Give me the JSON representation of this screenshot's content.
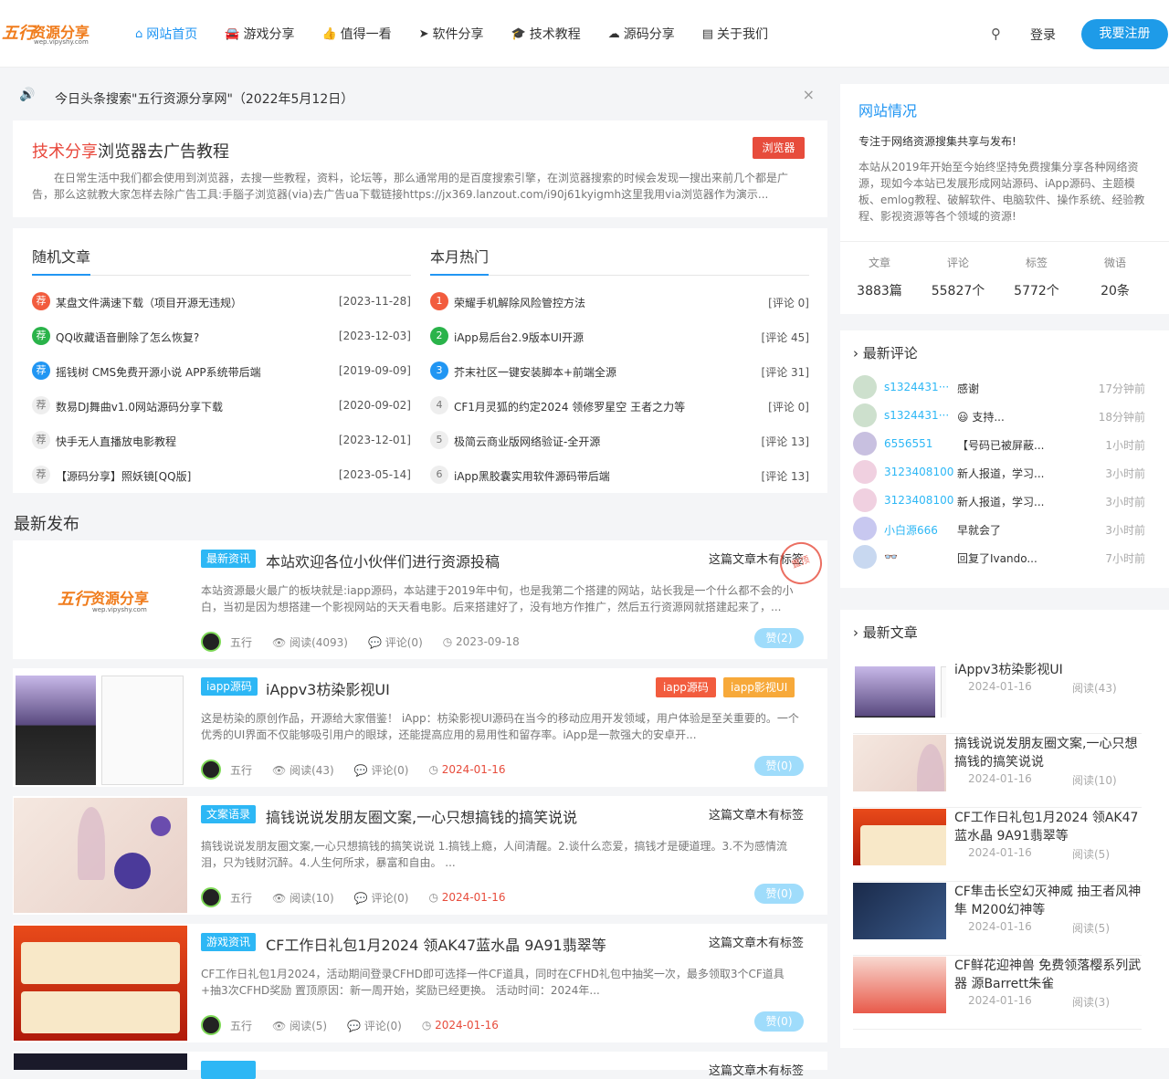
{
  "header": {
    "logo_main": "资源分享",
    "logo_mark": "五行",
    "logo_url": "wep.vipyshy.com",
    "nav": [
      {
        "label": "网站首页",
        "icon": "home-icon",
        "glyph": "⌂"
      },
      {
        "label": "游戏分享",
        "icon": "car-icon",
        "glyph": "🚘"
      },
      {
        "label": "值得一看",
        "icon": "thumbs-up-icon",
        "glyph": "👍"
      },
      {
        "label": "软件分享",
        "icon": "send-icon",
        "glyph": "➤"
      },
      {
        "label": "技术教程",
        "icon": "graduation-cap-icon",
        "glyph": "🎓"
      },
      {
        "label": "源码分享",
        "icon": "cloud-download-icon",
        "glyph": "☁"
      },
      {
        "label": "关于我们",
        "icon": "id-card-icon",
        "glyph": "▤"
      }
    ],
    "login": "登录",
    "register": "我要注册"
  },
  "notice": {
    "text": "今日头条搜索\"五行资源分享网\"（2022年5月12日）",
    "close": "×"
  },
  "feature": {
    "title_hl": "技术分享",
    "title": "浏览器去广告教程",
    "tag": "浏览器",
    "desc": "在日常生活中我们都会使用到浏览器，去搜一些教程，资料，论坛等，那么通常用的是百度搜索引擎，在浏览器搜索的时候会发现一搜出来前几个都是广告，那么这就教大家怎样去除广告工具:手腦子浏览器(via)去广告ua下载链接https://jx369.lanzout.com/i90j61kyigmh这里我用via浏览器作为演示..."
  },
  "random": {
    "title": "随机文章",
    "items": [
      {
        "badge": "荐",
        "color": "#f25c3e",
        "title": "某盘文件满速下载（项目开源无违规）",
        "right": "[2023-11-28]"
      },
      {
        "badge": "荐",
        "color": "#2ab34a",
        "title": "QQ收藏语音删除了怎么恢复?",
        "right": "[2023-12-03]"
      },
      {
        "badge": "荐",
        "color": "#2196f3",
        "title": "摇钱树 CMS免费开源小说 APP系统带后端",
        "right": "[2019-09-09]"
      },
      {
        "badge": "荐",
        "color": "#eeeeee",
        "title": "数易DJ舞曲v1.0网站源码分享下载",
        "right": "[2020-09-02]"
      },
      {
        "badge": "荐",
        "color": "#eeeeee",
        "title": "快手无人直播放电影教程",
        "right": "[2023-12-01]"
      },
      {
        "badge": "荐",
        "color": "#eeeeee",
        "title": "【源码分享】照妖镜[QQ版]",
        "right": "[2023-05-14]"
      }
    ]
  },
  "hot": {
    "title": "本月热门",
    "items": [
      {
        "badge": "1",
        "color": "#f25c3e",
        "title": "荣耀手机解除风险管控方法",
        "right": "[评论 0]"
      },
      {
        "badge": "2",
        "color": "#2ab34a",
        "title": "iApp易后台2.9版本UI开源",
        "right": "[评论 45]"
      },
      {
        "badge": "3",
        "color": "#2196f3",
        "title": "芥末社区一键安装脚本+前端全源",
        "right": "[评论 31]"
      },
      {
        "badge": "4",
        "color": "#eeeeee",
        "title": "CF1月灵狐的约定2024 领修罗星空 王者之力等",
        "right": "[评论 0]"
      },
      {
        "badge": "5",
        "color": "#eeeeee",
        "title": "极简云商业版网络验证-全开源",
        "right": "[评论 13]"
      },
      {
        "badge": "6",
        "color": "#eeeeee",
        "title": "iApp黑胶囊实用软件源码带后端",
        "right": "[评论 13]"
      }
    ]
  },
  "latest_title": "最新发布",
  "posts": [
    {
      "cat": "最新资讯",
      "cat_color": "#2db7f5",
      "title": "本站欢迎各位小伙伴们进行资源投稿",
      "notag": "这篇文章木有标签",
      "stamp": "置顶",
      "desc": "本站资源最火最广的板块就是:iapp源码，本站建于2019年中旬，也是我第二个搭建的网站，站长我是一个什么都不会的小白，当初是因为想搭建一个影视网站的天天看电影。后来搭建好了，没有地方作推广，然后五行资源网就搭建起来了，...",
      "author": "五行",
      "views": "阅读(4093)",
      "comments": "评论(0)",
      "date": "2023-09-18",
      "date_red": false,
      "like": "赞(2)",
      "thumb": "logo"
    },
    {
      "cat": "iapp源码",
      "cat_color": "#2db7f5",
      "title": "iAppv3枋染影视UI",
      "tags": [
        {
          "label": "iapp源码",
          "color": "#f25c3e"
        },
        {
          "label": "iapp影视UI",
          "color": "#f7a93a"
        }
      ],
      "desc": "这是枋染的原创作品，开源给大家借鉴！ iApp：枋染影视UI源码在当今的移动应用开发领域，用户体验是至关重要的。一个优秀的UI界面不仅能够吸引用户的眼球，还能提高应用的易用性和留存率。iApp是一款强大的安卓开...",
      "author": "五行",
      "views": "阅读(43)",
      "comments": "评论(0)",
      "date": "2024-01-16",
      "date_red": true,
      "like": "赞(0)",
      "thumb": "phone"
    },
    {
      "cat": "文案语录",
      "cat_color": "#2db7f5",
      "title": "搞钱说说发朋友圈文案,一心只想搞钱的搞笑说说",
      "notag": "这篇文章木有标签",
      "desc": "搞钱说说发朋友圈文案,一心只想搞钱的搞笑说说 1.搞钱上瘾，人间清醒。2.谈什么恋爱，搞钱才是硬道理。3.不为感情流泪，只为钱财沉醉。4.人生何所求，暴富和自由。 ...",
      "author": "五行",
      "views": "阅读(10)",
      "comments": "评论(0)",
      "date": "2024-01-16",
      "date_red": true,
      "like": "赞(0)",
      "thumb": "balloon"
    },
    {
      "cat": "游戏资讯",
      "cat_color": "#2db7f5",
      "title": "CF工作日礼包1月2024 领AK47蓝水晶 9A91翡翠等",
      "notag": "这篇文章木有标签",
      "desc": "CF工作日礼包1月2024，活动期间登录CFHD即可选择一件CF道具，同时在CFHD礼包中抽奖一次，最多领取3个CF道具+抽3次CFHD奖励 置顶原因：新一周开始，奖励已经更换。 活动时间：2024年...",
      "author": "五行",
      "views": "阅读(5)",
      "comments": "评论(0)",
      "date": "2024-01-16",
      "date_red": true,
      "like": "赞(0)",
      "thumb": "cf"
    }
  ],
  "next_post": {
    "notag": "这篇文章木有标签"
  },
  "site_info": {
    "title": "网站情况",
    "slogan": "专注于网络资源搜集共享与发布!",
    "desc": "本站从2019年开始至今始终坚持免费搜集分享各种网络资源，现如今本站已发展形成网站源码、iApp源码、主题模板、emlog教程、破解软件、电脑软件、操作系统、经验教程、影视资源等各个领域的资源!",
    "stats": [
      {
        "label": "文章",
        "value": "3883篇"
      },
      {
        "label": "评论",
        "value": "55827个"
      },
      {
        "label": "标签",
        "value": "5772个"
      },
      {
        "label": "微语",
        "value": "20条"
      }
    ]
  },
  "comments": {
    "title": "最新评论",
    "items": [
      {
        "name": "s1324431···",
        "text": "感谢",
        "time": "17分钟前"
      },
      {
        "name": "s1324431···",
        "text": "😃 支持...",
        "time": "18分钟前"
      },
      {
        "name": "6556551",
        "text": "【号码已被屏蔽...",
        "time": "1小时前"
      },
      {
        "name": "3123408100",
        "text": "新人报道，学习...",
        "time": "3小时前"
      },
      {
        "name": "3123408100",
        "text": "新人报道，学习...",
        "time": "3小时前"
      },
      {
        "name": "小白源666",
        "text": "早就会了",
        "time": "3小时前"
      },
      {
        "name": "👓",
        "text": "回复了Ivando...",
        "time": "7小时前"
      }
    ]
  },
  "recent": {
    "title": "最新文章",
    "items": [
      {
        "title": "iAppv3枋染影视UI",
        "date": "2024-01-16",
        "reads": "阅读(43)",
        "thumb": "phone"
      },
      {
        "title": "搞钱说说发朋友圈文案,一心只想搞钱的搞笑说说",
        "date": "2024-01-16",
        "reads": "阅读(10)",
        "thumb": "balloon"
      },
      {
        "title": "CF工作日礼包1月2024 领AK47蓝水晶 9A91翡翠等",
        "date": "2024-01-16",
        "reads": "阅读(5)",
        "thumb": "cf"
      },
      {
        "title": "CF隼击长空幻灭神威 抽王者风神隼 M200幻神等",
        "date": "2024-01-16",
        "reads": "阅读(5)",
        "thumb": "game"
      },
      {
        "title": "CF鲜花迎神兽 免费领落樱系列武器 源Barrett朱雀",
        "date": "2024-01-16",
        "reads": "阅读(3)",
        "thumb": "red"
      }
    ]
  }
}
